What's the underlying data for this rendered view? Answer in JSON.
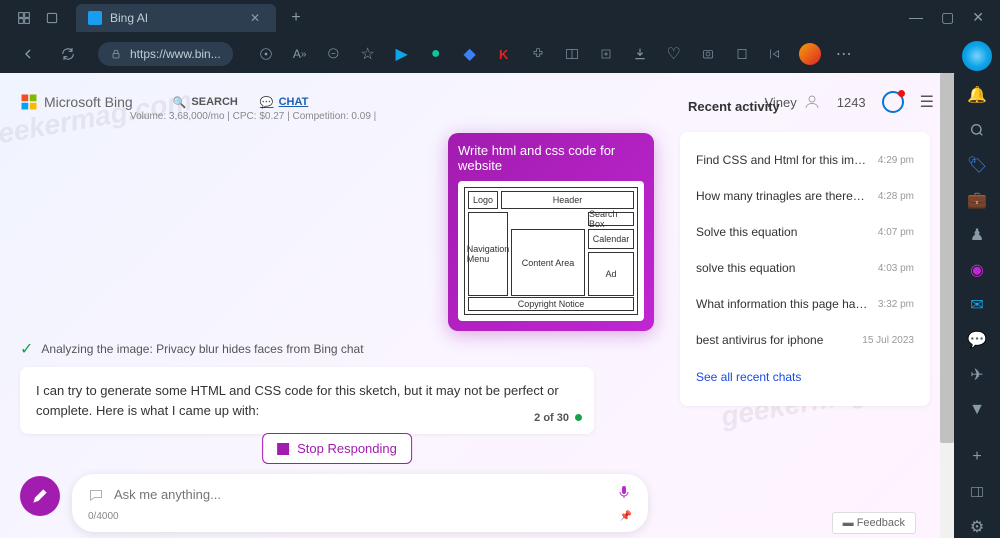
{
  "window": {
    "tab_title": "Bing AI",
    "url": "https://www.bin..."
  },
  "brand": "Microsoft Bing",
  "nav": {
    "search": "SEARCH",
    "chat": "CHAT"
  },
  "seo": "Volume: 3,68,000/mo | CPC: $0.27 | Competition: 0.09 |",
  "user": {
    "name": "Viney",
    "points": "1243"
  },
  "activity": {
    "title": "Recent activity",
    "items": [
      {
        "text": "Find CSS and Html for this image",
        "time": "4:29 pm"
      },
      {
        "text": "How many trinagles are there in this shape",
        "time": "4:28 pm"
      },
      {
        "text": "Solve this equation",
        "time": "4:07 pm"
      },
      {
        "text": "solve this equation",
        "time": "4:03 pm"
      },
      {
        "text": "What information this page has?",
        "time": "3:32 pm"
      },
      {
        "text": "best antivirus for iphone",
        "time": "15 Jul 2023"
      }
    ],
    "see_all": "See all recent chats"
  },
  "chat": {
    "user_message": "Write html and css code for website",
    "sketch": {
      "logo": "Logo",
      "header": "Header",
      "searchbox": "Search Box",
      "nav": "Navigation Menu",
      "calendar": "Calendar",
      "content": "Content Area",
      "ad": "Ad",
      "copyright": "Copyright Notice"
    },
    "analyzing": "Analyzing the image: Privacy blur hides faces from Bing chat",
    "bot_message": "I can try to generate some HTML and CSS code for this sketch, but it may not be perfect or complete. Here is what I came up with:",
    "counter": "2 of 30",
    "stop": "Stop Responding"
  },
  "input": {
    "placeholder": "Ask me anything...",
    "counter": "0/4000"
  },
  "feedback": "Feedback"
}
